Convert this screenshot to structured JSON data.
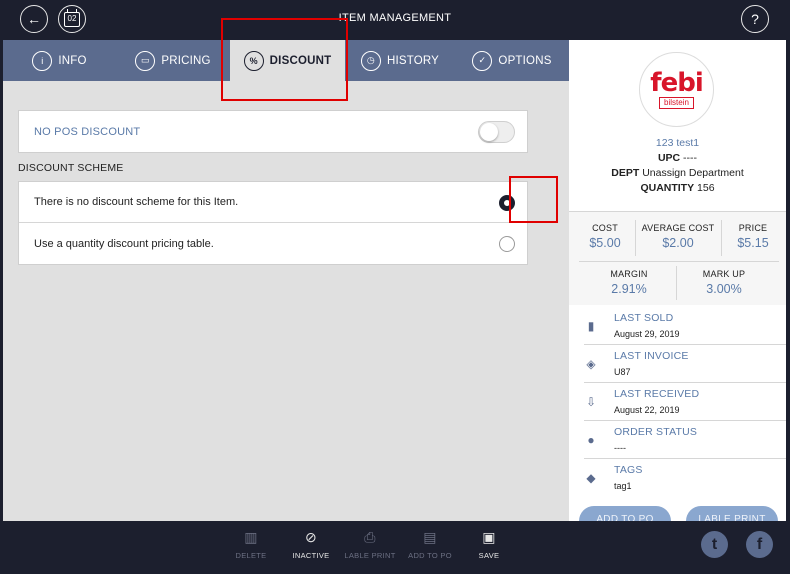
{
  "header": {
    "title": "ITEM MANAGEMENT",
    "back_icon": "arrow-left-icon",
    "calendar_day": "02",
    "help_label": "?"
  },
  "tabs": [
    {
      "label": "INFO",
      "icon_glyph": "i",
      "icon": "info-icon",
      "active": false
    },
    {
      "label": "PRICING",
      "icon_glyph": "▭",
      "icon": "money-icon",
      "active": false
    },
    {
      "label": "DISCOUNT",
      "icon_glyph": "%",
      "icon": "percent-icon",
      "active": true
    },
    {
      "label": "HISTORY",
      "icon_glyph": "◷",
      "icon": "clock-icon",
      "active": false
    },
    {
      "label": "OPTIONS",
      "icon_glyph": "✓",
      "icon": "check-icon",
      "active": false
    }
  ],
  "discount": {
    "no_pos_label": "NO POS DISCOUNT",
    "no_pos_enabled": false,
    "scheme_title": "DISCOUNT SCHEME",
    "options": [
      {
        "label": "There is no discount scheme for this Item.",
        "selected": true
      },
      {
        "label": "Use a quantity discount pricing table.",
        "selected": false
      }
    ]
  },
  "item": {
    "logo_text": "febi",
    "logo_sub": "bilstein",
    "name": "123 test1",
    "upc_label": "UPC",
    "upc_value": "----",
    "dept_label": "DEPT",
    "dept_value": "Unassign Department",
    "quantity_label": "QUANTITY",
    "quantity_value": "156"
  },
  "stats": {
    "cost_label": "COST",
    "cost_value": "$5.00",
    "avg_cost_label": "AVERAGE COST",
    "avg_cost_value": "$2.00",
    "price_label": "PRICE",
    "price_value": "$5.15",
    "margin_label": "MARGIN",
    "margin_value": "2.91%",
    "markup_label": "MARK UP",
    "markup_value": "3.00%"
  },
  "info": [
    {
      "title": "LAST SOLD",
      "value": "August 29, 2019",
      "icon": "shopping-bag-icon",
      "glyph": "▮"
    },
    {
      "title": "LAST INVOICE",
      "value": "U87",
      "icon": "layers-icon",
      "glyph": "◈"
    },
    {
      "title": "LAST RECEIVED",
      "value": "August 22, 2019",
      "icon": "inbox-icon",
      "glyph": "⇩"
    },
    {
      "title": "ORDER STATUS",
      "value": "----",
      "icon": "stopwatch-icon",
      "glyph": "●"
    },
    {
      "title": "TAGS",
      "value": "tag1",
      "icon": "tag-icon",
      "glyph": "◆"
    }
  ],
  "side_actions": {
    "add_to_po": "ADD TO PO",
    "label_print": "LABLE PRINT"
  },
  "toolbar": [
    {
      "label": "DELETE",
      "glyph": "🗑",
      "icon": "trash-icon",
      "enabled": false
    },
    {
      "label": "INACTIVE",
      "glyph": "⊘",
      "icon": "inactive-icon",
      "enabled": true
    },
    {
      "label": "LABLE PRINT",
      "glyph": "⎙",
      "icon": "label-printer-icon",
      "enabled": false
    },
    {
      "label": "ADD TO PO",
      "glyph": "▤",
      "icon": "purchase-order-icon",
      "enabled": false
    },
    {
      "label": "SAVE",
      "glyph": "💾",
      "icon": "save-icon",
      "enabled": true
    }
  ],
  "social": {
    "twitter_glyph": "t",
    "facebook_glyph": "f"
  }
}
